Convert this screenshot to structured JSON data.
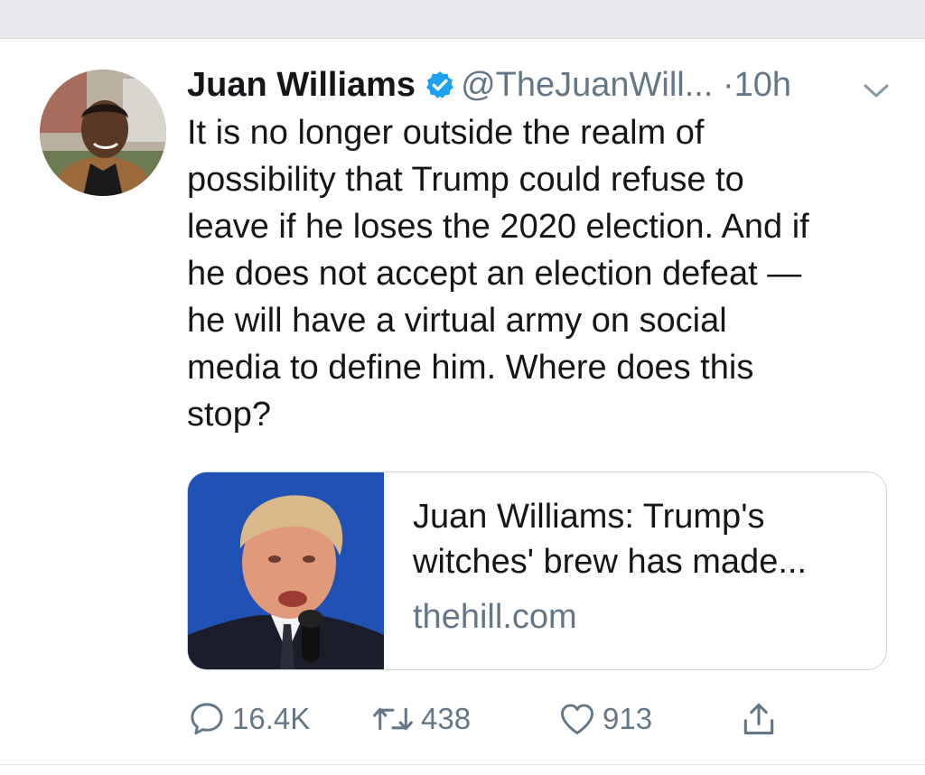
{
  "tweet": {
    "author_name": "Juan Williams",
    "handle": "@TheJuanWill...",
    "separator": "·",
    "time": "10h",
    "text": "It is no longer outside the realm of\npossibility that Trump could refuse to\nleave if he loses the 2020 election. And if\nhe does not accept an election defeat —\nhe will have a virtual army on social\nmedia to define him. Where does this\nstop?",
    "verified_icon": "verified-badge-icon",
    "more_icon": "chevron-down-icon"
  },
  "card": {
    "title": "Juan Williams: Trump's\nwitches' brew has made...",
    "domain": "thehill.com"
  },
  "actions": {
    "reply": {
      "icon": "reply-bubble-icon",
      "count": "16.4K"
    },
    "retweet": {
      "icon": "retweet-icon",
      "count": "438"
    },
    "like": {
      "icon": "heart-icon",
      "count": "913"
    },
    "share": {
      "icon": "share-icon"
    }
  },
  "colors": {
    "text": "#14171a",
    "secondary": "#657786",
    "verified": "#1da1f2",
    "top_strip": "#e8e9ec"
  }
}
